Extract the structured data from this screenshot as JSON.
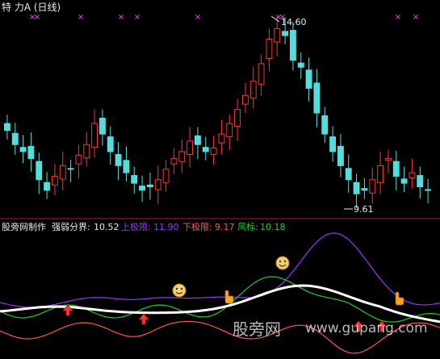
{
  "top_panel": {
    "title": "特 力A (日线)",
    "title_color": "#e8e8e8",
    "high_label": "14.60",
    "low_label": "9.61",
    "label_color": "#e8e8e8",
    "x_marker_color": "#ff44ff",
    "x_marker_count": 10
  },
  "bottom_panel": {
    "indicator_name": "股旁网制作",
    "strength_label": "强弱分界:",
    "strength_value": "10.52",
    "upper_label": "上极限:",
    "upper_value": "11.90",
    "lower_label": "下极限:",
    "lower_value": "9.17",
    "wind_label": "风标:",
    "wind_value": "10.18",
    "colors": {
      "strength": "#ffffff",
      "upper": "#9933ff",
      "lower": "#ff5555",
      "wind": "#22cc22",
      "up_candle": "#ff3333",
      "down_candle": "#55dddd"
    }
  },
  "watermark": {
    "site_cn": "股旁网",
    "site_en": "www.gupang.com"
  },
  "chart_data": [
    {
      "type": "candlestick",
      "title": "特 力A (日线)",
      "series": [
        {
          "name": "close",
          "values": [
            11.6,
            11.2,
            11.0,
            10.8,
            10.2,
            9.9,
            10.3,
            10.6,
            10.5,
            10.9,
            11.2,
            11.8,
            11.5,
            11.0,
            10.6,
            10.4,
            10.1,
            9.9,
            10.0,
            10.2,
            10.5,
            10.8,
            11.0,
            11.3,
            11.2,
            11.0,
            11.1,
            11.5,
            11.8,
            12.2,
            12.6,
            13.0,
            13.5,
            14.2,
            14.5,
            14.3,
            13.6,
            13.4,
            12.8,
            12.1,
            11.5,
            11.0,
            10.6,
            10.2,
            9.8,
            9.9,
            10.2,
            10.6,
            10.8,
            10.3,
            10.1,
            10.4,
            10.0,
            9.9
          ]
        }
      ],
      "price_labels": {
        "high": 14.6,
        "low": 9.61
      },
      "ylim": [
        9.3,
        14.9
      ]
    },
    {
      "type": "line",
      "series": [
        {
          "name": "强弱分界",
          "last_value": 10.52
        },
        {
          "name": "上极限",
          "last_value": 11.9
        },
        {
          "name": "下极限",
          "last_value": 9.17
        },
        {
          "name": "风标",
          "last_value": 10.18
        }
      ]
    }
  ]
}
